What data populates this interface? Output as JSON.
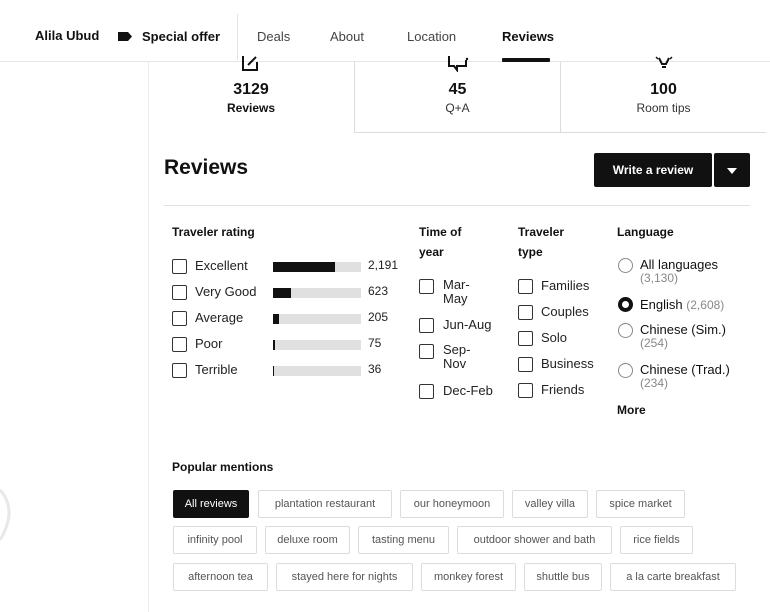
{
  "nav": {
    "hotel_name": "Alila Ubud",
    "offer_label": "Special offer",
    "tabs": [
      {
        "label": "Deals"
      },
      {
        "label": "About"
      },
      {
        "label": "Location"
      },
      {
        "label": "Reviews",
        "active": true
      }
    ]
  },
  "stats": [
    {
      "icon": "edit-icon",
      "value": "3129",
      "label": "Reviews"
    },
    {
      "icon": "chat-icon",
      "value": "45",
      "label": "Q+A"
    },
    {
      "icon": "lightbulb-icon",
      "value": "100",
      "label": "Room tips"
    }
  ],
  "reviews": {
    "title": "Reviews",
    "write_review_label": "Write a review"
  },
  "filters": {
    "traveler_rating": {
      "heading": "Traveler rating",
      "items": [
        {
          "label": "Excellent",
          "count": "2,191",
          "fraction": 0.7
        },
        {
          "label": "Very Good",
          "count": "623",
          "fraction": 0.2
        },
        {
          "label": "Average",
          "count": "205",
          "fraction": 0.07
        },
        {
          "label": "Poor",
          "count": "75",
          "fraction": 0.024
        },
        {
          "label": "Terrible",
          "count": "36",
          "fraction": 0.012
        }
      ]
    },
    "time_of_year": {
      "heading_line1": "Time of",
      "heading_line2": "year",
      "items": [
        {
          "line1": "Mar-",
          "line2": "May"
        },
        {
          "line1": "Jun-Aug",
          "line2": ""
        },
        {
          "line1": "Sep-",
          "line2": "Nov"
        },
        {
          "line1": "Dec-Feb",
          "line2": ""
        }
      ]
    },
    "traveler_type": {
      "heading_line1": "Traveler",
      "heading_line2": "type",
      "items": [
        "Families",
        "Couples",
        "Solo",
        "Business",
        "Friends"
      ]
    },
    "language": {
      "heading": "Language",
      "items": [
        {
          "label": "All languages",
          "count": "(3,130)",
          "selected": false
        },
        {
          "label": "English",
          "count": "(2,608)",
          "selected": true
        },
        {
          "label": "Chinese (Sim.)",
          "count": "(254)",
          "selected": false
        },
        {
          "label": "Chinese (Trad.)",
          "count": "(234)",
          "selected": false
        }
      ],
      "more_label": "More"
    }
  },
  "popular_mentions": {
    "title": "Popular mentions",
    "chips": [
      "All reviews",
      "plantation restaurant",
      "our honeymoon",
      "valley villa",
      "spice market",
      "infinity pool",
      "deluxe room",
      "tasting menu",
      "outdoor shower and bath",
      "rice fields",
      "afternoon tea",
      "stayed here for nights",
      "monkey forest",
      "shuttle bus",
      "a la carte breakfast"
    ]
  },
  "colors": {
    "accent": "#111111",
    "bar_track": "#e0e0e0",
    "muted_text": "#888888",
    "chip_border": "#dcdcdc"
  }
}
